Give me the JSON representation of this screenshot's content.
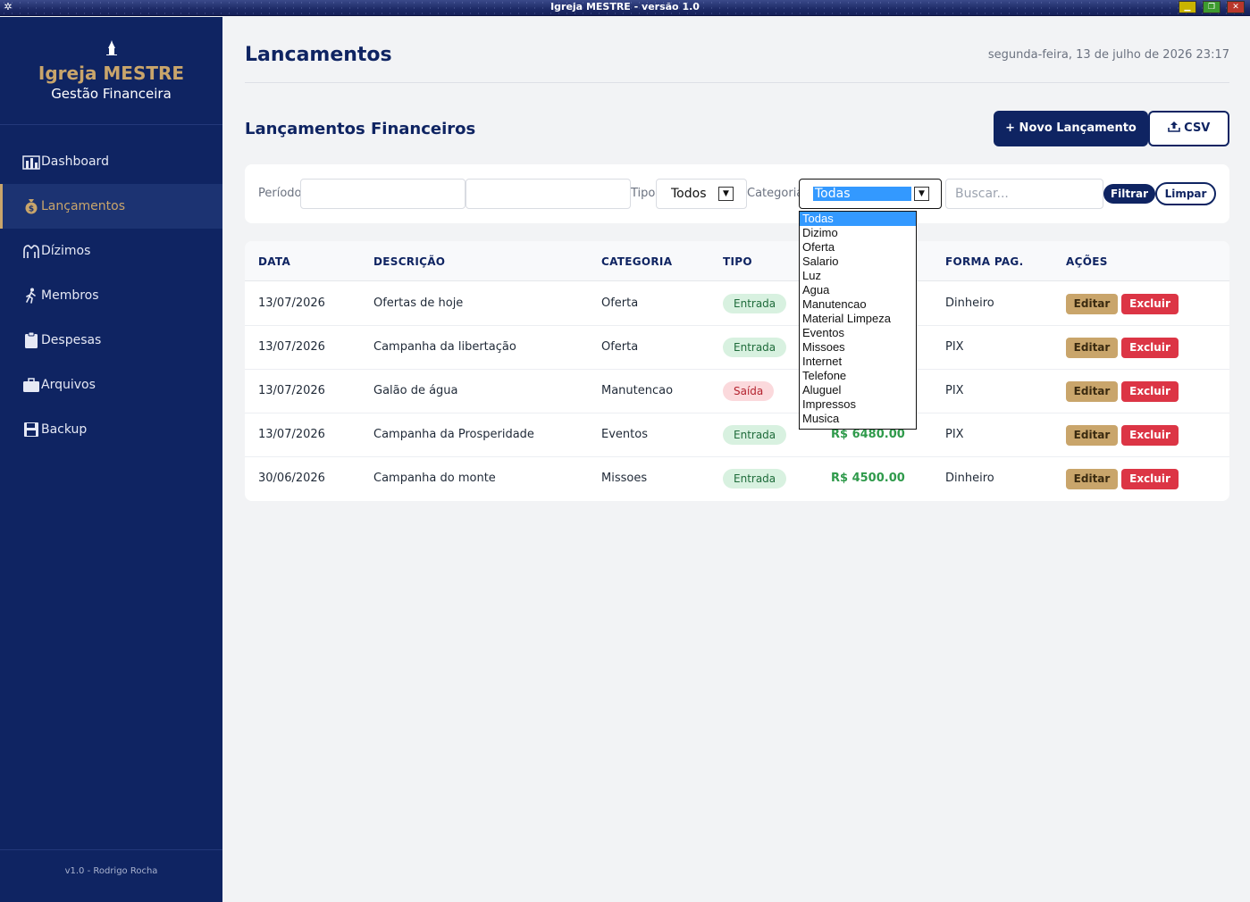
{
  "window": {
    "title": "Igreja MESTRE - versão 1.0"
  },
  "brand": {
    "name": "Igreja MESTRE",
    "subtitle": "Gestão Financeira"
  },
  "sidebar": {
    "items": [
      {
        "label": "Dashboard",
        "icon": "chart-bars-icon"
      },
      {
        "label": "Lançamentos",
        "icon": "money-bag-icon",
        "active": true
      },
      {
        "label": "Dízimos",
        "icon": "hands-icon"
      },
      {
        "label": "Membros",
        "icon": "person-walking-icon"
      },
      {
        "label": "Despesas",
        "icon": "clipboard-icon"
      },
      {
        "label": "Arquivos",
        "icon": "briefcase-icon"
      },
      {
        "label": "Backup",
        "icon": "floppy-disk-icon"
      }
    ],
    "footer": "v1.0 - Rodrigo Rocha"
  },
  "header": {
    "title": "Lancamentos",
    "datetime": "segunda-feira, 13 de julho de 2026 23:17"
  },
  "section": {
    "title": "Lançamentos Financeiros",
    "new_button": "+ Novo Lançamento",
    "csv_button": "CSV"
  },
  "filters": {
    "period_label": "Período:",
    "tipo_label": "Tipo:",
    "tipo_value": "Todos",
    "categoria_label": "Categoria:",
    "categoria_value": "Todas",
    "search_placeholder": "Buscar...",
    "filter_button": "Filtrar",
    "clear_button": "Limpar",
    "categoria_options": [
      "Todas",
      "Dizimo",
      "Oferta",
      "Salario",
      "Luz",
      "Agua",
      "Manutencao",
      "Material Limpeza",
      "Eventos",
      "Missoes",
      "Internet",
      "Telefone",
      "Aluguel",
      "Impressos",
      "Musica"
    ]
  },
  "table": {
    "headers": {
      "data": "DATA",
      "descricao": "DESCRIÇÃO",
      "categoria": "CATEGORIA",
      "tipo": "TIPO",
      "forma": "FORMA PAG.",
      "acoes": "AÇÕES"
    },
    "edit_label": "Editar",
    "delete_label": "Excluir",
    "rows": [
      {
        "data": "13/07/2026",
        "descricao": "Ofertas de hoje",
        "categoria": "Oferta",
        "tipo": "Entrada",
        "valor": "",
        "forma": "Dinheiro"
      },
      {
        "data": "13/07/2026",
        "descricao": "Campanha da libertação",
        "categoria": "Oferta",
        "tipo": "Entrada",
        "valor": "",
        "forma": "PIX"
      },
      {
        "data": "13/07/2026",
        "descricao": "Galão de água",
        "categoria": "Manutencao",
        "tipo": "Saída",
        "valor": "",
        "forma": "PIX"
      },
      {
        "data": "13/07/2026",
        "descricao": "Campanha da Prosperidade",
        "categoria": "Eventos",
        "tipo": "Entrada",
        "valor": "R$ 6480.00",
        "forma": "PIX"
      },
      {
        "data": "30/06/2026",
        "descricao": "Campanha do monte",
        "categoria": "Missoes",
        "tipo": "Entrada",
        "valor": "R$ 4500.00",
        "forma": "Dinheiro"
      }
    ]
  },
  "colors": {
    "navy": "#0f2462",
    "gold": "#c9a56b",
    "green": "#2f9a4b",
    "red": "#dc3545"
  }
}
